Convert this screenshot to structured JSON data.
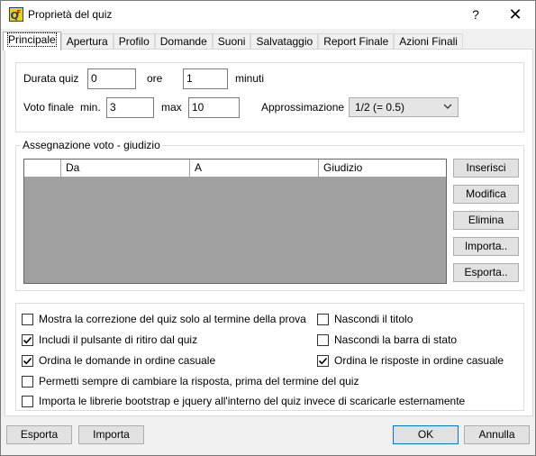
{
  "window": {
    "title": "Proprietà del quiz",
    "help_label": "?",
    "close_label": "✕"
  },
  "tabs": [
    {
      "label": "Principale",
      "active": true
    },
    {
      "label": "Apertura"
    },
    {
      "label": "Profilo"
    },
    {
      "label": "Domande"
    },
    {
      "label": "Suoni"
    },
    {
      "label": "Salvataggio"
    },
    {
      "label": "Report Finale"
    },
    {
      "label": "Azioni Finali"
    }
  ],
  "settings": {
    "durata_label": "Durata quiz",
    "ore_value": "0",
    "ore_label": "ore",
    "minuti_value": "1",
    "minuti_label": "minuti",
    "voto_label": "Voto finale",
    "min_label": "min.",
    "min_value": "3",
    "max_label": "max",
    "max_value": "10",
    "approssimazione_label": "Approssimazione",
    "approssimazione_value": "1/2 (= 0.5)"
  },
  "assegnazione": {
    "title": "Assegnazione voto - giudizio",
    "columns": [
      "",
      "Da",
      "A",
      "Giudizio"
    ],
    "rows": [],
    "buttons": [
      "Inserisci",
      "Modifica",
      "Elimina",
      "Importa..",
      "Esporta.."
    ]
  },
  "options": [
    {
      "label": "Mostra la correzione del quiz solo al termine della prova",
      "checked": false
    },
    {
      "label": "Nascondi il titolo",
      "checked": false
    },
    {
      "label": "Includi il pulsante di ritiro dal quiz",
      "checked": true
    },
    {
      "label": "Nascondi la barra di stato",
      "checked": false
    },
    {
      "label": "Ordina le domande in ordine casuale",
      "checked": true
    },
    {
      "label": "Ordina le risposte in ordine casuale",
      "checked": true
    },
    {
      "label": "Permetti sempre di cambiare la risposta, prima del termine del quiz",
      "checked": false
    },
    {
      "label": "Importa le librerie bootstrap e jquery all'interno del quiz invece di scaricarle esternamente",
      "checked": false
    }
  ],
  "footer": {
    "esporta_label": "Esporta",
    "importa_label": "Importa",
    "ok_label": "OK",
    "annulla_label": "Annulla"
  },
  "colors": {
    "accent": "#0078d7",
    "grid_background": "#a0a0a0"
  }
}
